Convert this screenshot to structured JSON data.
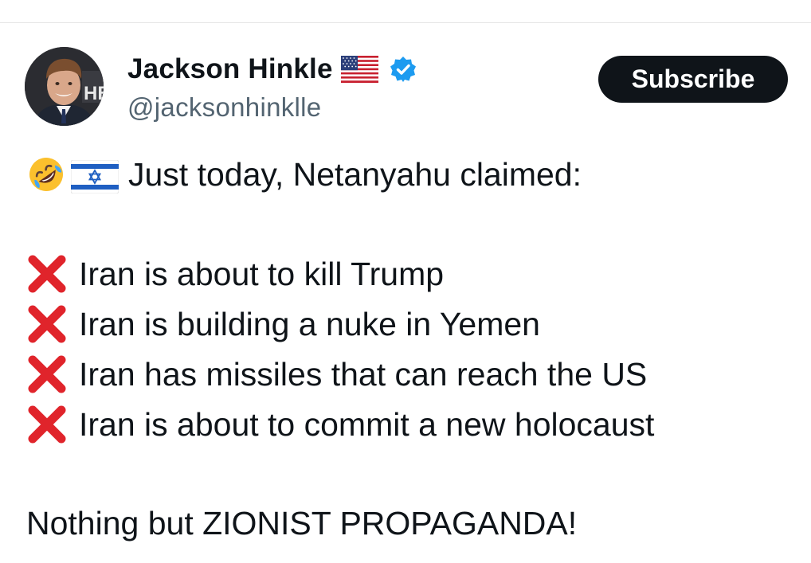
{
  "author": {
    "display_name": "Jackson Hinkle",
    "handle": "@jacksonhinklle",
    "avatar_text": "HB"
  },
  "icons": {
    "flag": "us-flag-icon",
    "verified": "verified-badge-icon",
    "rofl": "rofl-emoji-icon",
    "israel_flag": "israel-flag-icon",
    "cross": "cross-mark-icon"
  },
  "colors": {
    "verified_blue": "#1d9bf0",
    "cross_red": "#e0242b",
    "button_bg": "#0f1419",
    "handle_gray": "#536471"
  },
  "subscribe_label": "Subscribe",
  "tweet": {
    "intro": "Just today, Netanyahu claimed:",
    "claims": [
      "Iran is about to kill Trump",
      "Iran is building a nuke in Yemen",
      "Iran has missiles that can reach the US",
      "Iran is about to commit a new holocaust"
    ],
    "closing": "Nothing but ZIONIST PROPAGANDA!"
  }
}
